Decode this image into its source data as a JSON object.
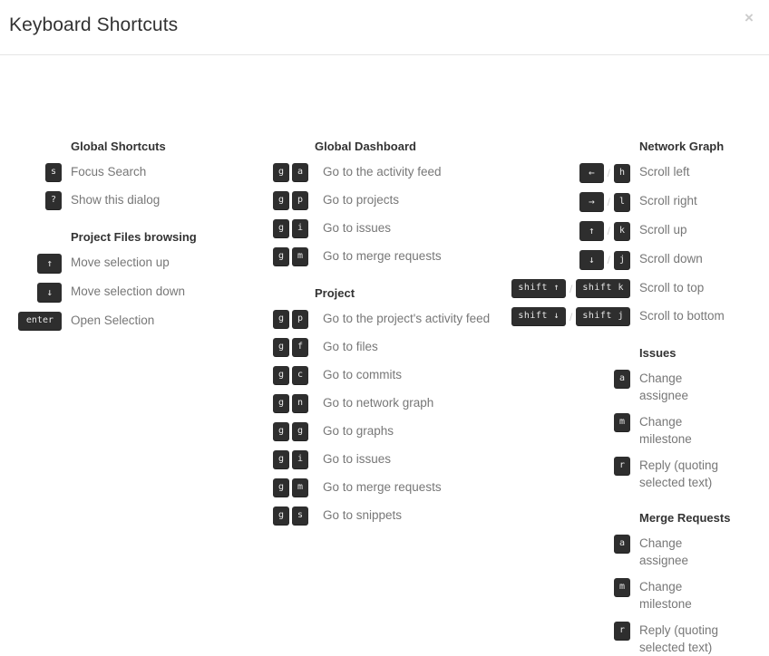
{
  "dialog": {
    "title": "Keyboard Shortcuts",
    "close_label": "×",
    "close_icon": "close-icon"
  },
  "colors": {
    "key_background": "#2e2e2e",
    "key_text": "#e8e8e8",
    "description_text": "#777777",
    "heading_text": "#333333",
    "divider": "#e5e5e5",
    "close_icon": "#cccccc",
    "page_background": "#ffffff"
  },
  "columns": [
    {
      "id": "column-1",
      "sections": [
        {
          "heading": "Global Shortcuts",
          "rows": [
            {
              "keys": [
                {
                  "label": "s",
                  "type": "letter"
                }
              ],
              "description": "Focus Search"
            },
            {
              "keys": [
                {
                  "label": "?",
                  "type": "letter"
                }
              ],
              "description": "Show this dialog"
            }
          ]
        },
        {
          "heading": "Project Files browsing",
          "rows": [
            {
              "keys": [
                {
                  "label": "↑",
                  "type": "arrow"
                }
              ],
              "description": "Move selection up"
            },
            {
              "keys": [
                {
                  "label": "↓",
                  "type": "arrow"
                }
              ],
              "description": "Move selection down"
            },
            {
              "keys": [
                {
                  "label": "enter",
                  "type": "word"
                }
              ],
              "description": "Open Selection"
            }
          ]
        }
      ]
    },
    {
      "id": "column-2",
      "sections": [
        {
          "heading": "Global Dashboard",
          "rows": [
            {
              "keys": [
                {
                  "label": "g",
                  "type": "letter"
                },
                {
                  "label": "a",
                  "type": "letter"
                }
              ],
              "description": "Go to the activity feed"
            },
            {
              "keys": [
                {
                  "label": "g",
                  "type": "letter"
                },
                {
                  "label": "p",
                  "type": "letter"
                }
              ],
              "description": "Go to projects"
            },
            {
              "keys": [
                {
                  "label": "g",
                  "type": "letter"
                },
                {
                  "label": "i",
                  "type": "letter"
                }
              ],
              "description": "Go to issues"
            },
            {
              "keys": [
                {
                  "label": "g",
                  "type": "letter"
                },
                {
                  "label": "m",
                  "type": "letter"
                }
              ],
              "description": "Go to merge requests"
            }
          ]
        },
        {
          "heading": "Project",
          "rows": [
            {
              "keys": [
                {
                  "label": "g",
                  "type": "letter"
                },
                {
                  "label": "p",
                  "type": "letter"
                }
              ],
              "description": "Go to the project's activity feed"
            },
            {
              "keys": [
                {
                  "label": "g",
                  "type": "letter"
                },
                {
                  "label": "f",
                  "type": "letter"
                }
              ],
              "description": "Go to files"
            },
            {
              "keys": [
                {
                  "label": "g",
                  "type": "letter"
                },
                {
                  "label": "c",
                  "type": "letter"
                }
              ],
              "description": "Go to commits"
            },
            {
              "keys": [
                {
                  "label": "g",
                  "type": "letter"
                },
                {
                  "label": "n",
                  "type": "letter"
                }
              ],
              "description": "Go to network graph"
            },
            {
              "keys": [
                {
                  "label": "g",
                  "type": "letter"
                },
                {
                  "label": "g",
                  "type": "letter"
                }
              ],
              "description": "Go to graphs"
            },
            {
              "keys": [
                {
                  "label": "g",
                  "type": "letter"
                },
                {
                  "label": "i",
                  "type": "letter"
                }
              ],
              "description": "Go to issues"
            },
            {
              "keys": [
                {
                  "label": "g",
                  "type": "letter"
                },
                {
                  "label": "m",
                  "type": "letter"
                }
              ],
              "description": "Go to merge requests"
            },
            {
              "keys": [
                {
                  "label": "g",
                  "type": "letter"
                },
                {
                  "label": "s",
                  "type": "letter"
                }
              ],
              "description": "Go to snippets"
            }
          ]
        }
      ]
    },
    {
      "id": "column-3",
      "sections": [
        {
          "heading": "Network Graph",
          "rows": [
            {
              "keys": [
                {
                  "label": "←",
                  "type": "arrow"
                },
                {
                  "label": "/",
                  "type": "separator"
                },
                {
                  "label": "h",
                  "type": "letter"
                }
              ],
              "description": "Scroll left"
            },
            {
              "keys": [
                {
                  "label": "→",
                  "type": "arrow"
                },
                {
                  "label": "/",
                  "type": "separator"
                },
                {
                  "label": "l",
                  "type": "letter"
                }
              ],
              "description": "Scroll right"
            },
            {
              "keys": [
                {
                  "label": "↑",
                  "type": "arrow"
                },
                {
                  "label": "/",
                  "type": "separator"
                },
                {
                  "label": "k",
                  "type": "letter"
                }
              ],
              "description": "Scroll up"
            },
            {
              "keys": [
                {
                  "label": "↓",
                  "type": "arrow"
                },
                {
                  "label": "/",
                  "type": "separator"
                },
                {
                  "label": "j",
                  "type": "letter"
                }
              ],
              "description": "Scroll down"
            },
            {
              "keys": [
                {
                  "label": "shift ↑",
                  "type": "combo"
                },
                {
                  "label": "/",
                  "type": "separator"
                },
                {
                  "label": "shift k",
                  "type": "combo"
                }
              ],
              "description": "Scroll to top"
            },
            {
              "keys": [
                {
                  "label": "shift ↓",
                  "type": "combo"
                },
                {
                  "label": "/",
                  "type": "separator"
                },
                {
                  "label": "shift j",
                  "type": "combo"
                }
              ],
              "description": "Scroll to bottom"
            }
          ]
        },
        {
          "heading": "Issues",
          "rows": [
            {
              "keys": [
                {
                  "label": "a",
                  "type": "letter"
                }
              ],
              "description": "Change assignee"
            },
            {
              "keys": [
                {
                  "label": "m",
                  "type": "letter"
                }
              ],
              "description": "Change milestone"
            },
            {
              "keys": [
                {
                  "label": "r",
                  "type": "letter"
                }
              ],
              "description": "Reply (quoting selected text)"
            }
          ]
        },
        {
          "heading": "Merge Requests",
          "rows": [
            {
              "keys": [
                {
                  "label": "a",
                  "type": "letter"
                }
              ],
              "description": "Change assignee"
            },
            {
              "keys": [
                {
                  "label": "m",
                  "type": "letter"
                }
              ],
              "description": "Change milestone"
            },
            {
              "keys": [
                {
                  "label": "r",
                  "type": "letter"
                }
              ],
              "description": "Reply (quoting selected text)"
            }
          ]
        }
      ]
    }
  ]
}
